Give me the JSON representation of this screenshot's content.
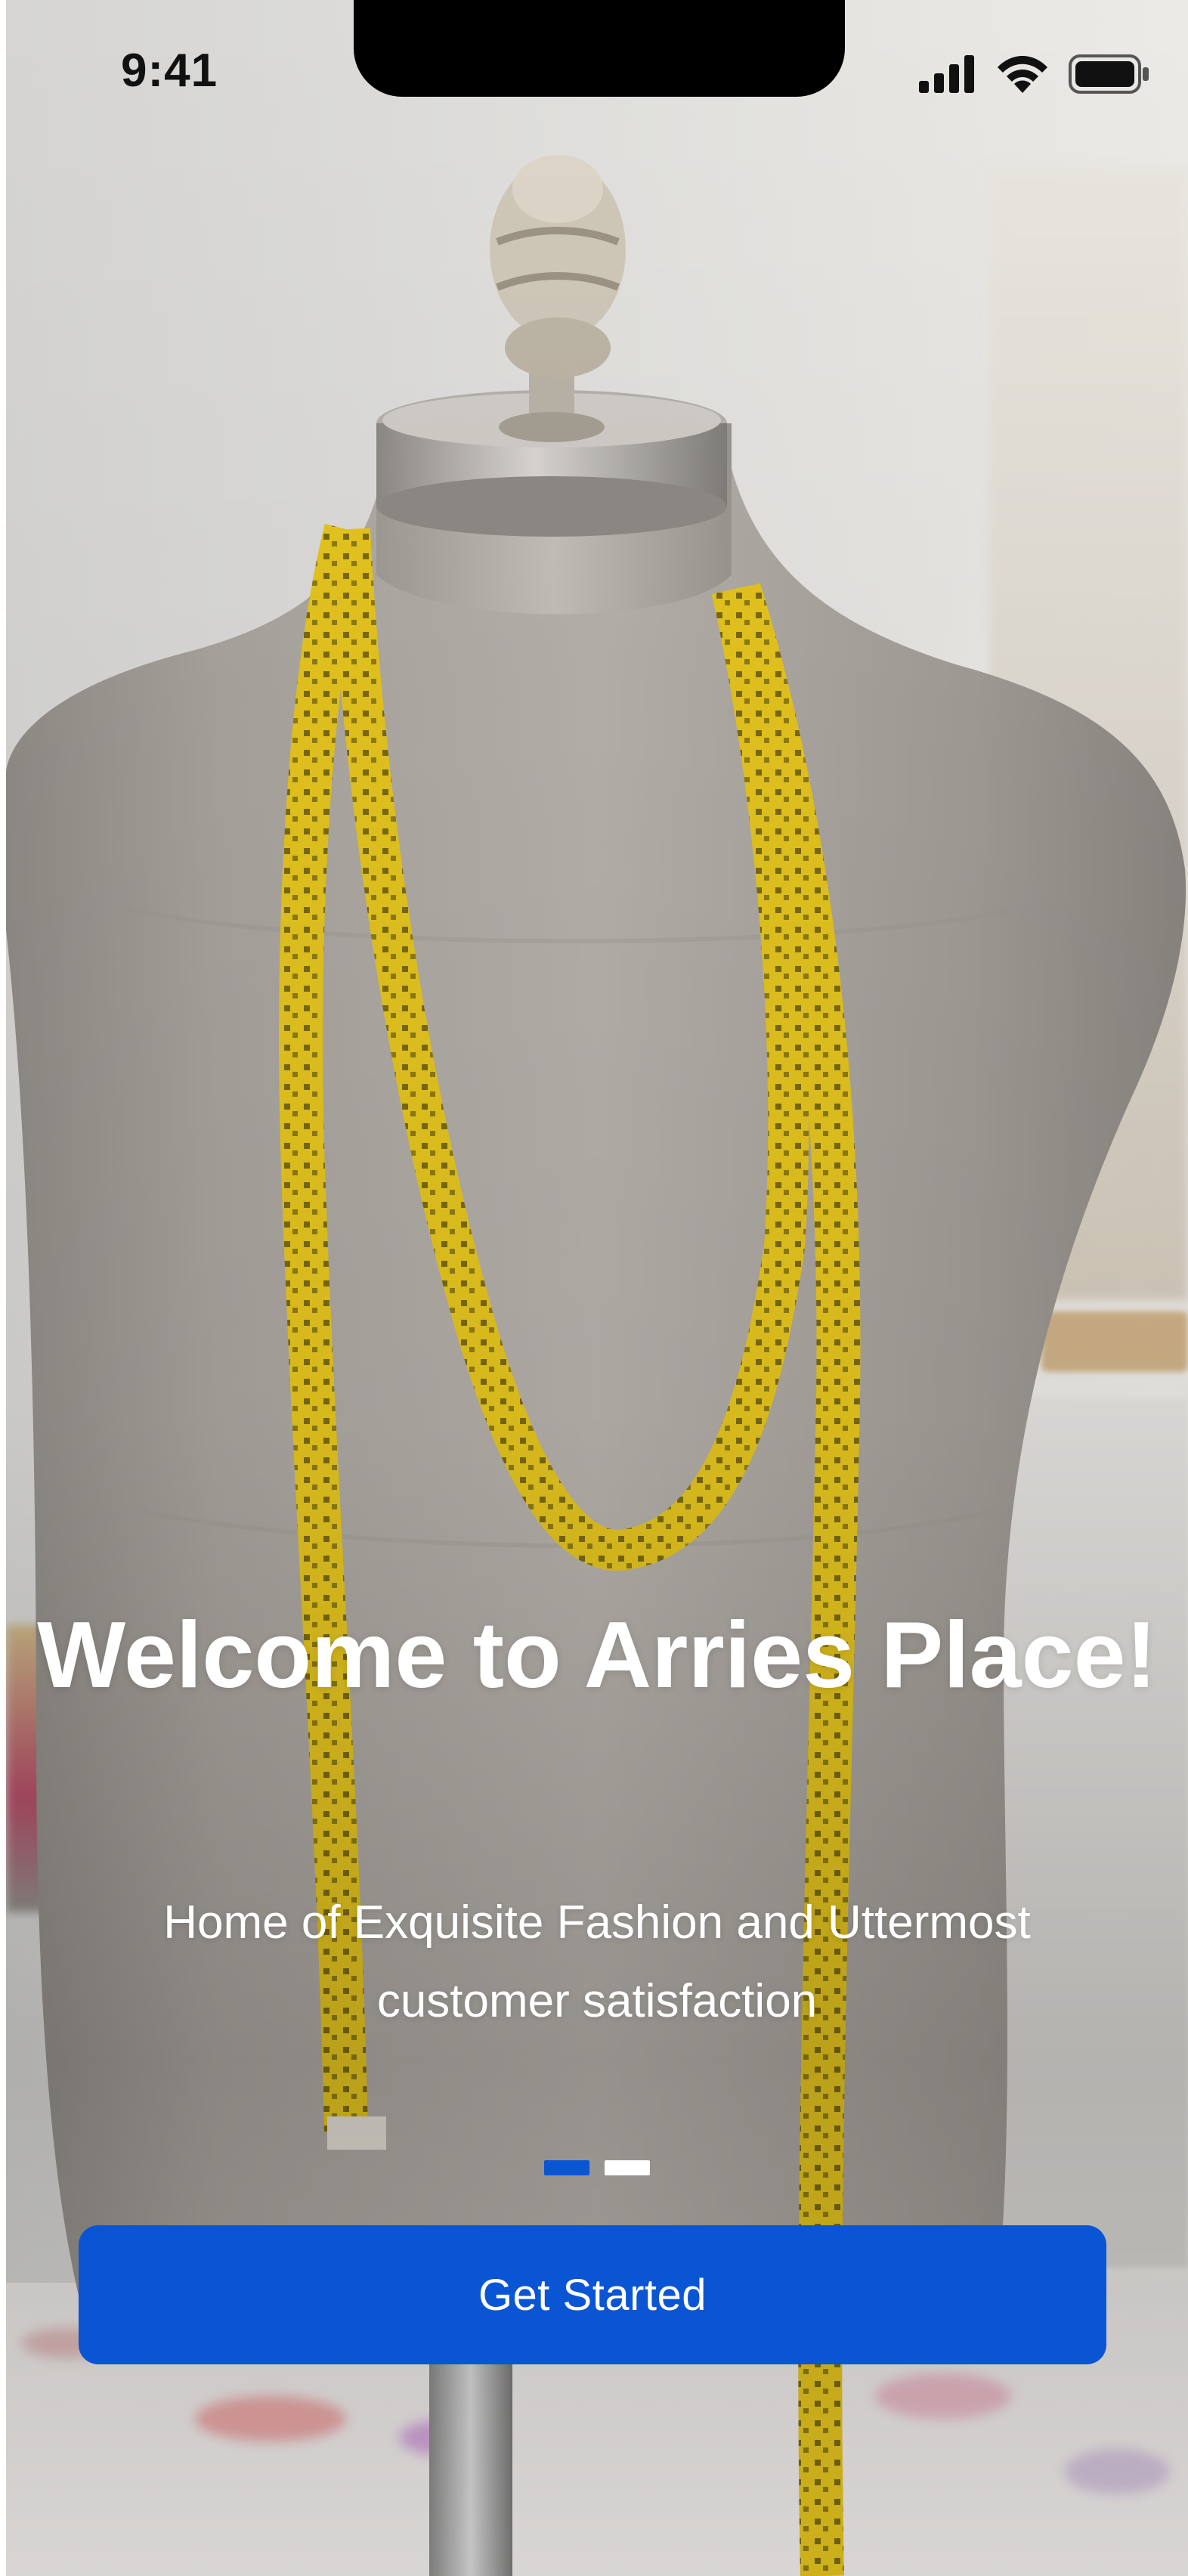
{
  "status_bar": {
    "time": "9:41",
    "signal_icon": "cellular-signal-icon",
    "wifi_icon": "wifi-icon",
    "battery_icon": "battery-icon"
  },
  "onboarding": {
    "background_image": "mannequin-with-measuring-tape",
    "title": "Welcome to Arries Place!",
    "subtitle": "Home of Exquisite Fashion and Uttermost customer satisfaction",
    "pagination": {
      "total": 2,
      "active_index": 0
    },
    "cta_label": "Get Started"
  },
  "colors": {
    "primary": "#0a55d4",
    "dot_active": "#0a55d4",
    "dot_inactive": "#ffffff",
    "text_on_image": "#ffffff"
  }
}
